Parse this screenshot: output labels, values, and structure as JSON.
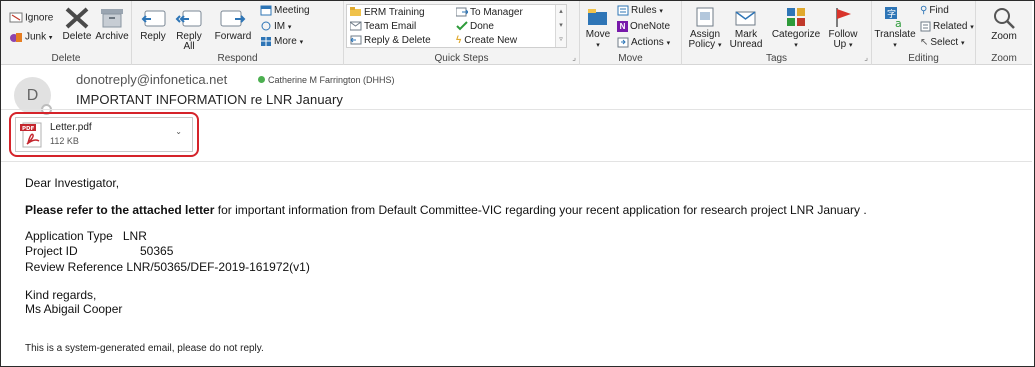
{
  "ribbon": {
    "delete_group": {
      "label": "Delete",
      "ignore": "Ignore",
      "junk": "Junk",
      "delete": "Delete",
      "archive": "Archive"
    },
    "respond_group": {
      "label": "Respond",
      "reply": "Reply",
      "reply_all_1": "Reply",
      "reply_all_2": "All",
      "forward": "Forward",
      "meeting": "Meeting",
      "im": "IM",
      "more": "More"
    },
    "quick_steps": {
      "label": "Quick Steps",
      "items": [
        "ERM Training",
        "To Manager",
        "Team Email",
        "Done",
        "Reply & Delete",
        "Create New"
      ]
    },
    "move_group": {
      "label": "Move",
      "move": "Move",
      "rules": "Rules",
      "onenote": "OneNote",
      "actions": "Actions"
    },
    "tags_group": {
      "label": "Tags",
      "assign_policy_1": "Assign",
      "assign_policy_2": "Policy",
      "mark_unread_1": "Mark",
      "mark_unread_2": "Unread",
      "categorize": "Categorize",
      "follow_up_1": "Follow",
      "follow_up_2": "Up"
    },
    "editing_group": {
      "label": "Editing",
      "translate": "Translate",
      "find": "Find",
      "related": "Related",
      "select": "Select"
    },
    "zoom_group": {
      "label": "Zoom",
      "zoom": "Zoom"
    }
  },
  "message": {
    "avatar_letter": "D",
    "sender": "donotreply@infonetica.net",
    "recipient": "Catherine M Farrington (DHHS)",
    "subject": "IMPORTANT INFORMATION re LNR January"
  },
  "attachment": {
    "name": "Letter.pdf",
    "size": "112 KB",
    "icon_label": "PDF"
  },
  "body": {
    "greeting": "Dear Investigator,",
    "refer_bold": "Please refer to the attached letter",
    "refer_rest": " for important information from Default Committee-VIC regarding your recent application for research project LNR January .",
    "app_type_label": "Application Type",
    "app_type_value": "LNR",
    "project_id_label": "Project ID",
    "project_id_value": "50365",
    "review_ref_label": "Review Reference",
    "review_ref_value": "LNR/50365/DEF-2019-161972(v1)",
    "regards": "Kind regards,",
    "signature": "Ms Abigail Cooper",
    "footer": "This is a system-generated email, please do not reply."
  },
  "colors": {
    "highlight_border": "#d5232a",
    "presence_green": "#4caf50",
    "ribbon_bg": "#f3f3f3"
  }
}
